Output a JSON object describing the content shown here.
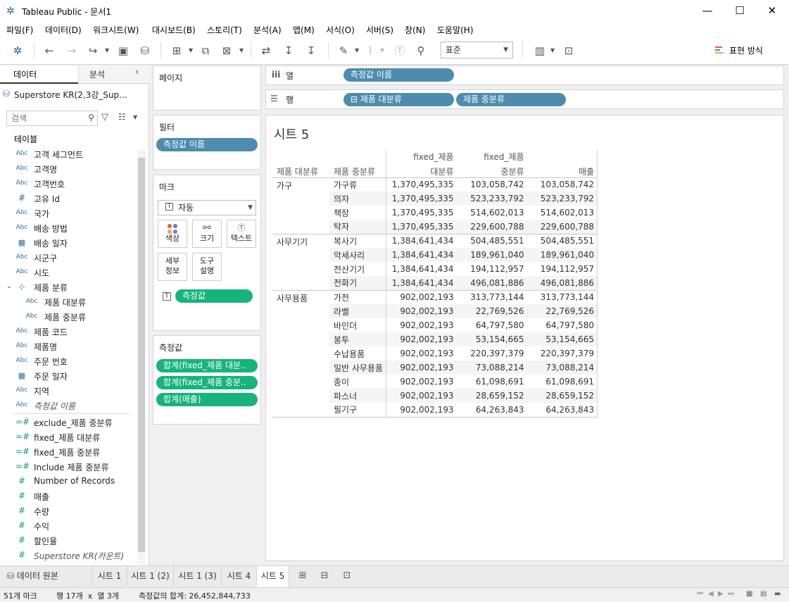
{
  "window": {
    "title": "Tableau Public - 문서1",
    "minimize": "—",
    "maximize": "☐",
    "close": "✕"
  },
  "menu": [
    "파일(F)",
    "데이터(D)",
    "워크시트(W)",
    "대시보드(B)",
    "스토리(T)",
    "분석(A)",
    "맵(M)",
    "서식(O)",
    "서버(S)",
    "창(N)",
    "도움말(H)"
  ],
  "toolbar": {
    "fit_select": "표준",
    "show_me": "표현 방식"
  },
  "data_pane": {
    "tab_data": "데이터",
    "tab_analysis": "분석",
    "datasource": "Superstore KR(2,3강_Sup...",
    "search_placeholder": "검색",
    "tables_header": "테이블",
    "fields": [
      {
        "type": "Abc",
        "name": "고객 세그먼트"
      },
      {
        "type": "Abc",
        "name": "고객명"
      },
      {
        "type": "Abc",
        "name": "고객번호"
      },
      {
        "type": "#",
        "name": "고유 Id"
      },
      {
        "type": "Abc",
        "name": "국가"
      },
      {
        "type": "Abc",
        "name": "배송 방법"
      },
      {
        "type": "date",
        "name": "배송 일자"
      },
      {
        "type": "Abc",
        "name": "시군구"
      },
      {
        "type": "Abc",
        "name": "시도"
      },
      {
        "type": "hier",
        "name": "제품 분류"
      },
      {
        "type": "Abc",
        "name": "제품 대분류"
      },
      {
        "type": "Abc",
        "name": "제품 중분류"
      },
      {
        "type": "Abc",
        "name": "제품 코드"
      },
      {
        "type": "Abc",
        "name": "제품명"
      },
      {
        "type": "Abc",
        "name": "주문 번호"
      },
      {
        "type": "date",
        "name": "주문 일자"
      },
      {
        "type": "Abc",
        "name": "지역"
      },
      {
        "type": "Abc",
        "name": "측정값 이름"
      }
    ],
    "measures": [
      {
        "type": "=#",
        "name": "exclude_제품 중분류"
      },
      {
        "type": "=#",
        "name": "fixed_제품 대분류"
      },
      {
        "type": "=#",
        "name": "fixed_제품 중분류"
      },
      {
        "type": "=#",
        "name": "Include 제품 중분류"
      },
      {
        "type": "#",
        "name": "Number of Records"
      },
      {
        "type": "#",
        "name": "매출"
      },
      {
        "type": "#",
        "name": "수량"
      },
      {
        "type": "#",
        "name": "수익"
      },
      {
        "type": "#",
        "name": "할인율"
      },
      {
        "type": "#",
        "name": "Superstore KR(카운트)"
      }
    ]
  },
  "cards": {
    "pages": "페이지",
    "filters": "필터",
    "filter_pill": "측정값 이름",
    "marks": "마크",
    "mark_type": "자동",
    "mark_buttons": {
      "color": "색상",
      "size": "크기",
      "text": "텍스트",
      "detail_1": "세부",
      "detail_2": "정보",
      "tooltip_1": "도구",
      "tooltip_2": "설명"
    },
    "mark_pill": "측정값",
    "measure_values": "측정값",
    "mv_pills": [
      "합계(fixed_제품 대분..",
      "합계(fixed_제품 중분..",
      "합계(매출)"
    ]
  },
  "shelves": {
    "columns_label": "열",
    "columns_pill": "측정값 이름",
    "rows_label": "행",
    "rows_pills": [
      "⊟ 제품 대분류",
      "제품 중분류"
    ]
  },
  "sheet": {
    "title": "시트 5",
    "headers": {
      "h1": "제품 대분류",
      "h2": "제품 중분류",
      "h3a": "fixed_제품",
      "h3b": "대분류",
      "h4a": "fixed_제품",
      "h4b": "중분류",
      "h5": "매출"
    },
    "rows": [
      {
        "cat": "가구",
        "sub": "가구류",
        "a": "1,370,495,335",
        "b": "103,058,742",
        "c": "103,058,742"
      },
      {
        "cat": "",
        "sub": "의자",
        "a": "1,370,495,335",
        "b": "523,233,792",
        "c": "523,233,792"
      },
      {
        "cat": "",
        "sub": "책장",
        "a": "1,370,495,335",
        "b": "514,602,013",
        "c": "514,602,013"
      },
      {
        "cat": "",
        "sub": "탁자",
        "a": "1,370,495,335",
        "b": "229,600,788",
        "c": "229,600,788"
      },
      {
        "cat": "사무기기",
        "sub": "복사기",
        "a": "1,384,641,434",
        "b": "504,485,551",
        "c": "504,485,551"
      },
      {
        "cat": "",
        "sub": "악세사리",
        "a": "1,384,641,434",
        "b": "189,961,040",
        "c": "189,961,040"
      },
      {
        "cat": "",
        "sub": "전산기기",
        "a": "1,384,641,434",
        "b": "194,112,957",
        "c": "194,112,957"
      },
      {
        "cat": "",
        "sub": "전화기",
        "a": "1,384,641,434",
        "b": "496,081,886",
        "c": "496,081,886"
      },
      {
        "cat": "사무용품",
        "sub": "가전",
        "a": "902,002,193",
        "b": "313,773,144",
        "c": "313,773,144"
      },
      {
        "cat": "",
        "sub": "라벨",
        "a": "902,002,193",
        "b": "22,769,526",
        "c": "22,769,526"
      },
      {
        "cat": "",
        "sub": "바인더",
        "a": "902,002,193",
        "b": "64,797,580",
        "c": "64,797,580"
      },
      {
        "cat": "",
        "sub": "봉투",
        "a": "902,002,193",
        "b": "53,154,665",
        "c": "53,154,665"
      },
      {
        "cat": "",
        "sub": "수납용품",
        "a": "902,002,193",
        "b": "220,397,379",
        "c": "220,397,379"
      },
      {
        "cat": "",
        "sub": "일반 사무용품",
        "a": "902,002,193",
        "b": "73,088,214",
        "c": "73,088,214"
      },
      {
        "cat": "",
        "sub": "종이",
        "a": "902,002,193",
        "b": "61,098,691",
        "c": "61,098,691"
      },
      {
        "cat": "",
        "sub": "파스너",
        "a": "902,002,193",
        "b": "28,659,152",
        "c": "28,659,152"
      },
      {
        "cat": "",
        "sub": "필기구",
        "a": "902,002,193",
        "b": "64,263,843",
        "c": "64,263,843"
      }
    ]
  },
  "tabs": {
    "datasource": "데이터 원본",
    "sheets": [
      "시트 1",
      "시트 1 (2)",
      "시트 1 (3)",
      "시트 4",
      "시트 5"
    ]
  },
  "status": {
    "marks": "51개 마크",
    "rows_cols": "행 17개  x  열 3개",
    "sum": "측정값의 합계: 26,452,844,733"
  }
}
